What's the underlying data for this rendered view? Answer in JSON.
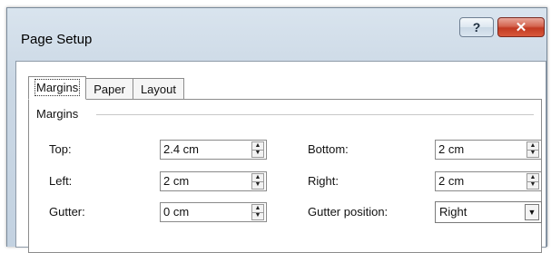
{
  "window": {
    "title": "Page Setup",
    "help_glyph": "?",
    "close_glyph": "✕"
  },
  "tabs": [
    {
      "label": "Margins",
      "active": true
    },
    {
      "label": "Paper",
      "active": false
    },
    {
      "label": "Layout",
      "active": false
    }
  ],
  "margins": {
    "group_label": "Margins",
    "top": {
      "label": "Top:",
      "value": "2.4 cm"
    },
    "left": {
      "label": "Left:",
      "value": "2 cm"
    },
    "gutter": {
      "label": "Gutter:",
      "value": "0 cm"
    },
    "bottom": {
      "label": "Bottom:",
      "value": "2 cm"
    },
    "right": {
      "label": "Right:",
      "value": "2 cm"
    },
    "gutter_position": {
      "label": "Gutter position:",
      "value": "Right"
    }
  },
  "icons": {
    "spin_up": "▲",
    "spin_down": "▼",
    "dropdown": "▼"
  }
}
